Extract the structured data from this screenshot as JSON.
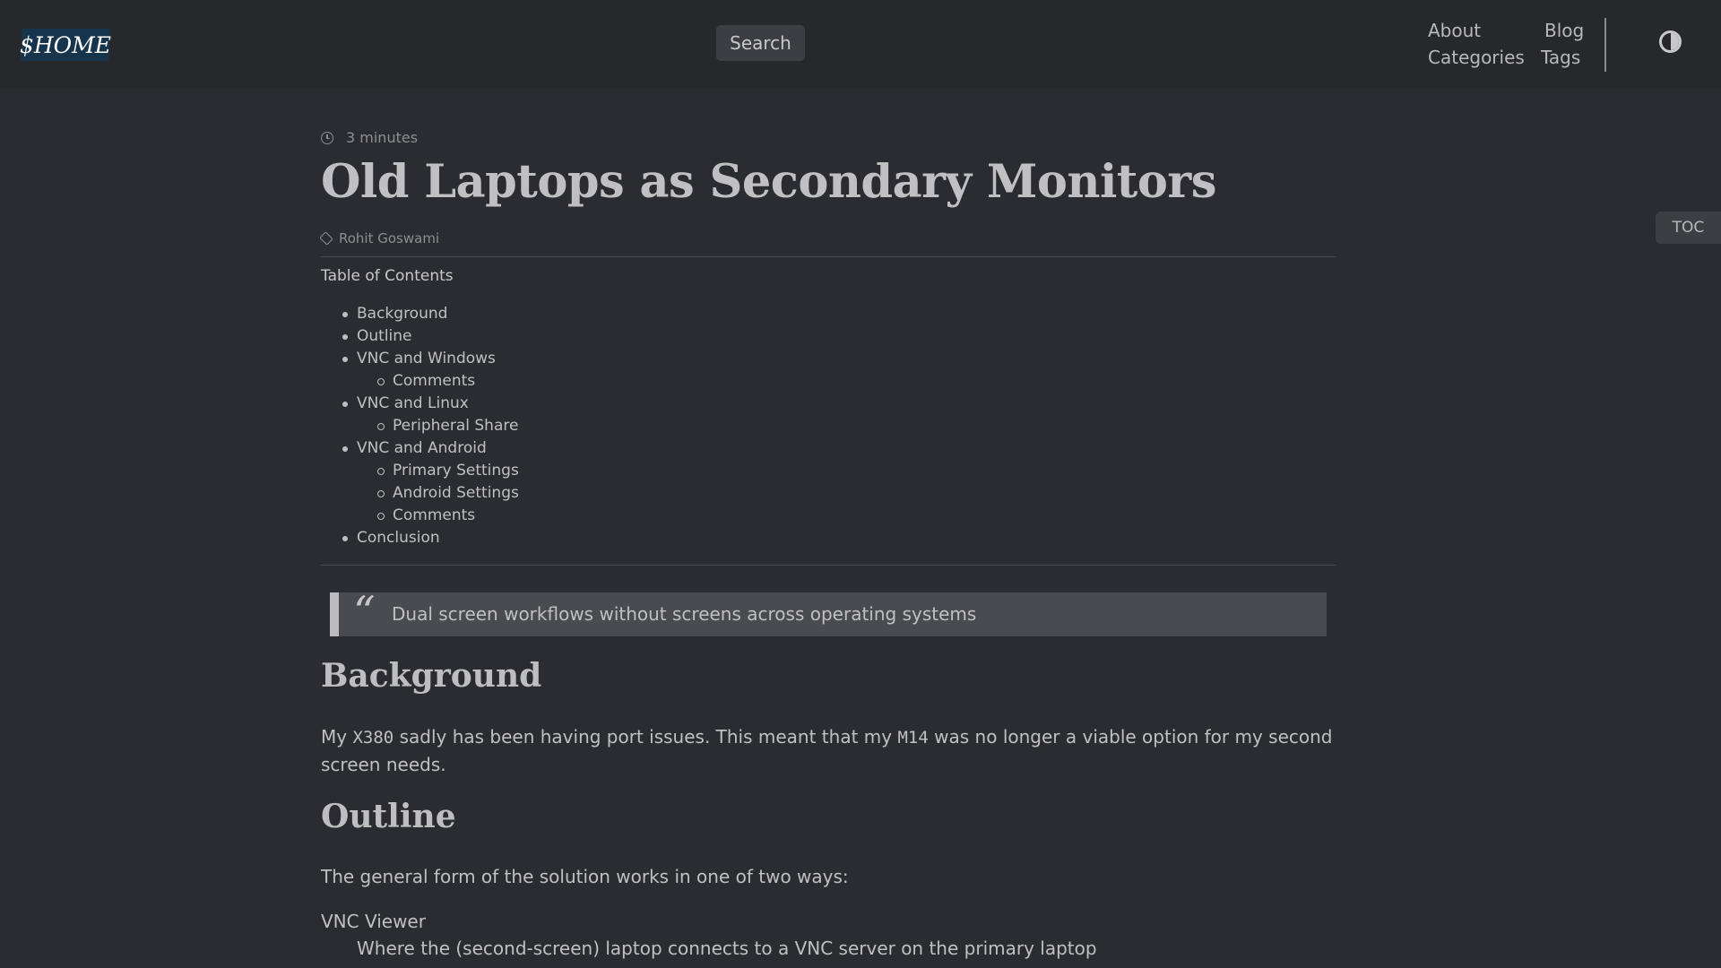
{
  "header": {
    "logo_text": "$HOME",
    "search_label": "Search",
    "nav": {
      "about": "About",
      "blog": "Blog",
      "categories": "Categories",
      "tags": "Tags"
    }
  },
  "toc_tab_label": "TOC",
  "post": {
    "reading_time": "3 minutes",
    "title": "Old Laptops as Secondary Monitors",
    "author": "Rohit Goswami",
    "toc_heading": "Table of Contents",
    "toc": [
      {
        "label": "Background",
        "level": 1
      },
      {
        "label": "Outline",
        "level": 1
      },
      {
        "label": "VNC and Windows",
        "level": 1
      },
      {
        "label": "Comments",
        "level": 2
      },
      {
        "label": "VNC and Linux",
        "level": 1
      },
      {
        "label": "Peripheral Share",
        "level": 2
      },
      {
        "label": "VNC and Android",
        "level": 1
      },
      {
        "label": "Primary Settings",
        "level": 2
      },
      {
        "label": "Android Settings",
        "level": 2
      },
      {
        "label": "Comments",
        "level": 2
      },
      {
        "label": "Conclusion",
        "level": 1
      }
    ],
    "quote_mark": "“",
    "quote": "Dual screen workflows without screens across operating systems",
    "background_heading": "Background",
    "background_text_pre": "My ",
    "background_code1": "X380",
    "background_text_mid": " sadly has been having port issues. This meant that my ",
    "background_code2": "M14",
    "background_text_post": " was no longer a viable option for my second screen needs.",
    "outline_heading": "Outline",
    "outline_intro": "The general form of the solution works in one of two ways:",
    "def_term": "VNC Viewer",
    "def_desc": "Where the (second-screen) laptop connects to a VNC server on the primary laptop"
  }
}
